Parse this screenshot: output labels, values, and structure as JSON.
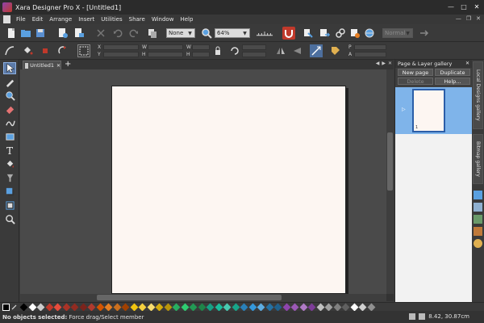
{
  "window": {
    "title": "Xara Designer Pro X - [Untitled1]"
  },
  "menu": {
    "items": [
      "File",
      "Edit",
      "Arrange",
      "Insert",
      "Utilities",
      "Share",
      "Window",
      "Help"
    ]
  },
  "toolbar": {
    "quality_value": "None",
    "zoom_value": "64%",
    "disabled_select_value": "Normal"
  },
  "infobar": {
    "labels": {
      "x": "X",
      "y": "Y",
      "w": "W",
      "h": "H",
      "w2": "W",
      "h2": "H",
      "p": "P",
      "a": "A"
    }
  },
  "document": {
    "tab_label": "Untitled1",
    "add_tab": "+"
  },
  "gallery": {
    "title": "Page & Layer gallery",
    "new_page": "New page",
    "duplicate": "Duplicate",
    "delete": "Delete",
    "help": "Help...",
    "page_number": "1"
  },
  "side_tabs": {
    "local_designs": "Local Designs gallery",
    "bitmap": "Bitmap gallery"
  },
  "status": {
    "bold": "No objects selected:",
    "message": " Force drag/Select member",
    "coords": "8.42, 30.87cm"
  },
  "colors": {
    "accent": "#7fb4ea",
    "page": "#fdf6f2",
    "palette": [
      "#000000",
      "#ffffff",
      "#cccccc",
      "#c0392b",
      "#e74c3c",
      "#a93226",
      "#922b21",
      "#7b241c",
      "#b03a2e",
      "#d35400",
      "#e67e22",
      "#ca6f1e",
      "#a04000",
      "#f1c40f",
      "#f4d03f",
      "#f7dc6f",
      "#d4ac0d",
      "#b7950b",
      "#27ae60",
      "#2ecc71",
      "#229954",
      "#1e8449",
      "#16a085",
      "#1abc9c",
      "#48c9b0",
      "#17a589",
      "#2980b9",
      "#3498db",
      "#5dade2",
      "#2471a3",
      "#1f618d",
      "#8e44ad",
      "#9b59b6",
      "#af7ac5",
      "#7d3c98",
      "#c0c0c0",
      "#a0a0a0",
      "#808080",
      "#606060",
      "#ffffff",
      "#d0d0d0",
      "#909090"
    ]
  }
}
